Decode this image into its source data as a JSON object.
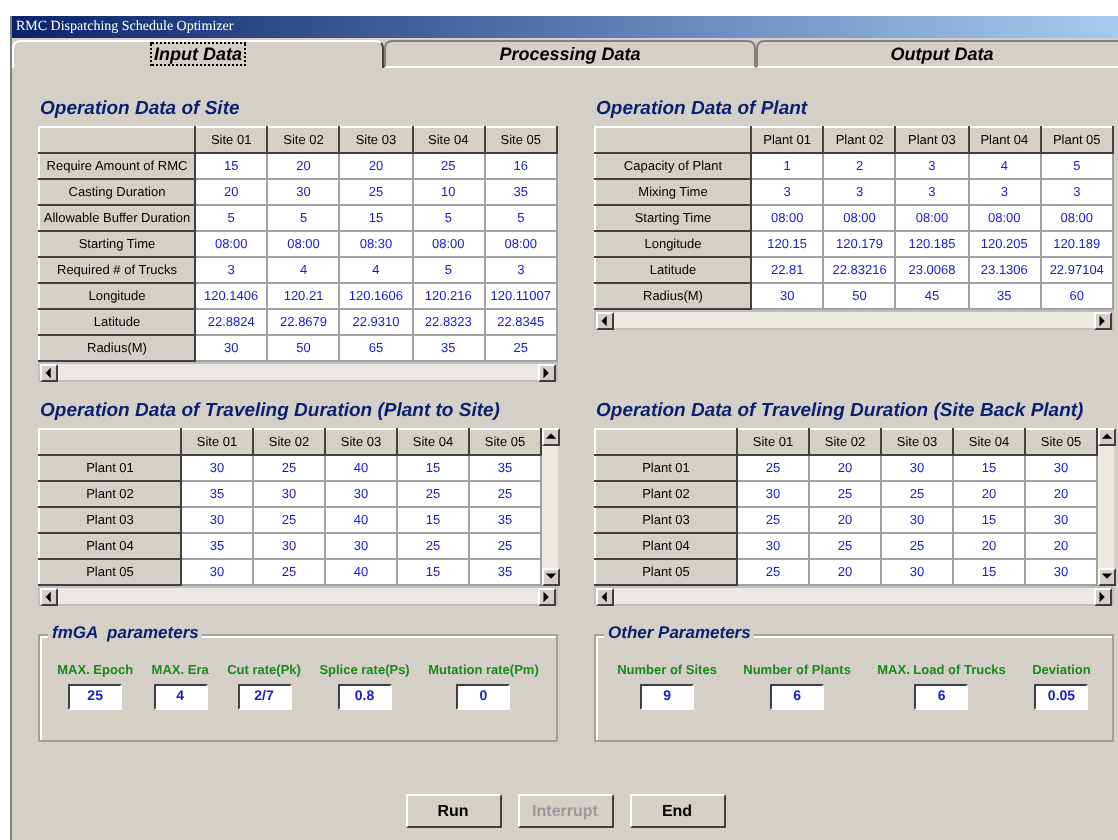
{
  "window": {
    "title": "RMC Dispatching Schedule Optimizer"
  },
  "tabs": [
    {
      "label": "Input Data",
      "selected": true
    },
    {
      "label": "Processing Data",
      "selected": false
    },
    {
      "label": "Output Data",
      "selected": false
    }
  ],
  "site_table": {
    "title": "Operation Data of Site",
    "columns": [
      "Site 01",
      "Site 02",
      "Site 03",
      "Site 04",
      "Site 05"
    ],
    "rows": [
      {
        "label": "Require Amount of RMC",
        "cells": [
          "15",
          "20",
          "20",
          "25",
          "16"
        ]
      },
      {
        "label": "Casting Duration",
        "cells": [
          "20",
          "30",
          "25",
          "10",
          "35"
        ]
      },
      {
        "label": "Allowable Buffer Duration",
        "cells": [
          "5",
          "5",
          "15",
          "5",
          "5"
        ]
      },
      {
        "label": "Starting Time",
        "cells": [
          "08:00",
          "08:00",
          "08:30",
          "08:00",
          "08:00"
        ]
      },
      {
        "label": "Required # of Trucks",
        "cells": [
          "3",
          "4",
          "4",
          "5",
          "3"
        ]
      },
      {
        "label": "Longitude",
        "cells": [
          "120.1406",
          "120.21",
          "120.1606",
          "120.216",
          "120.11007"
        ]
      },
      {
        "label": "Latitude",
        "cells": [
          "22.8824",
          "22.8679",
          "22.9310",
          "22.8323",
          "22.8345"
        ]
      },
      {
        "label": "Radius(M)",
        "cells": [
          "30",
          "50",
          "65",
          "35",
          "25"
        ]
      }
    ]
  },
  "plant_table": {
    "title": "Operation Data of Plant",
    "columns": [
      "Plant 01",
      "Plant 02",
      "Plant 03",
      "Plant 04",
      "Plant 05"
    ],
    "rows": [
      {
        "label": "Capacity of Plant",
        "cells": [
          "1",
          "2",
          "3",
          "4",
          "5"
        ]
      },
      {
        "label": "Mixing Time",
        "cells": [
          "3",
          "3",
          "3",
          "3",
          "3"
        ]
      },
      {
        "label": "Starting Time",
        "cells": [
          "08:00",
          "08:00",
          "08:00",
          "08:00",
          "08:00"
        ]
      },
      {
        "label": "Longitude",
        "cells": [
          "120.15",
          "120.179",
          "120.185",
          "120.205",
          "120.189"
        ]
      },
      {
        "label": "Latitude",
        "cells": [
          "22.81",
          "22.83216",
          "23.0068",
          "23.1306",
          "22.97104"
        ]
      },
      {
        "label": "Radius(M)",
        "cells": [
          "30",
          "50",
          "45",
          "35",
          "60"
        ]
      }
    ]
  },
  "plant_to_site_table": {
    "title": "Operation Data of Traveling Duration (Plant to Site)",
    "columns": [
      "Site 01",
      "Site 02",
      "Site 03",
      "Site 04",
      "Site 05"
    ],
    "rows": [
      {
        "label": "Plant 01",
        "cells": [
          "30",
          "25",
          "40",
          "15",
          "35"
        ]
      },
      {
        "label": "Plant 02",
        "cells": [
          "35",
          "30",
          "30",
          "25",
          "25"
        ]
      },
      {
        "label": "Plant 03",
        "cells": [
          "30",
          "25",
          "40",
          "15",
          "35"
        ]
      },
      {
        "label": "Plant 04",
        "cells": [
          "35",
          "30",
          "30",
          "25",
          "25"
        ]
      },
      {
        "label": "Plant 05",
        "cells": [
          "30",
          "25",
          "40",
          "15",
          "35"
        ]
      }
    ]
  },
  "site_back_plant_table": {
    "title": "Operation Data of Traveling Duration (Site Back Plant)",
    "columns": [
      "Site 01",
      "Site 02",
      "Site 03",
      "Site 04",
      "Site 05"
    ],
    "rows": [
      {
        "label": "Plant 01",
        "cells": [
          "25",
          "20",
          "30",
          "15",
          "30"
        ]
      },
      {
        "label": "Plant 02",
        "cells": [
          "30",
          "25",
          "25",
          "20",
          "20"
        ]
      },
      {
        "label": "Plant 03",
        "cells": [
          "25",
          "20",
          "30",
          "15",
          "30"
        ]
      },
      {
        "label": "Plant 04",
        "cells": [
          "30",
          "25",
          "25",
          "20",
          "20"
        ]
      },
      {
        "label": "Plant 05",
        "cells": [
          "25",
          "20",
          "30",
          "15",
          "30"
        ]
      }
    ]
  },
  "fmga_parameters": {
    "title": "fmGA  parameters",
    "fields": [
      {
        "label": "MAX. Epoch",
        "value": "25"
      },
      {
        "label": "MAX. Era",
        "value": "4"
      },
      {
        "label": "Cut rate(Pk)",
        "value": "2/7"
      },
      {
        "label": "Splice rate(Ps)",
        "value": "0.8"
      },
      {
        "label": "Mutation rate(Pm)",
        "value": "0"
      }
    ]
  },
  "other_parameters": {
    "title": "Other Parameters",
    "fields": [
      {
        "label": "Number of Sites",
        "value": "9"
      },
      {
        "label": "Number of Plants",
        "value": "6"
      },
      {
        "label": "MAX. Load of Trucks",
        "value": "6"
      },
      {
        "label": "Deviation",
        "value": "0.05"
      }
    ]
  },
  "buttons": [
    {
      "label": "Run",
      "disabled": false
    },
    {
      "label": "Interrupt",
      "disabled": true
    },
    {
      "label": "End",
      "disabled": false
    }
  ]
}
